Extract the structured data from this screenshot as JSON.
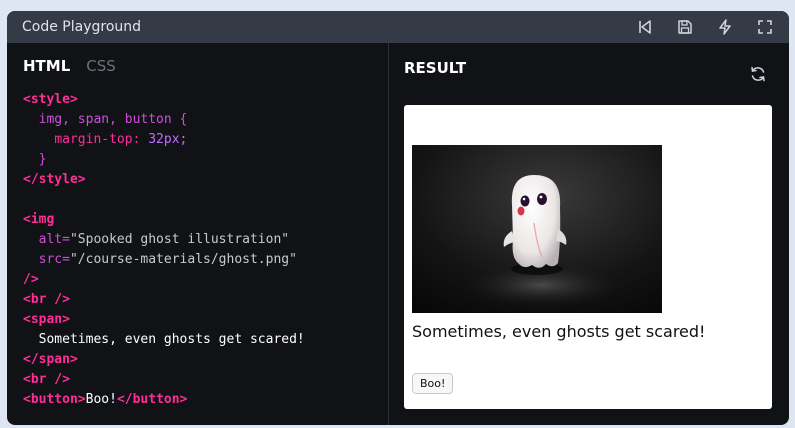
{
  "window": {
    "title": "Code Playground"
  },
  "toolbar": {
    "icons": [
      "rewind-icon",
      "save-icon",
      "lightning-icon",
      "fullscreen-icon"
    ]
  },
  "editor": {
    "tabs": [
      {
        "label": "HTML",
        "active": true
      },
      {
        "label": "CSS",
        "active": false
      }
    ]
  },
  "code": {
    "l1": "<style>",
    "l2_sel": "img, span, button {",
    "l3_prop": "margin-top:",
    "l3_val": "32px;",
    "l4": "}",
    "l5": "</style>",
    "l7": "<img",
    "l8_attr": "alt=",
    "l8_val": "\"Spooked ghost illustration\"",
    "l9_attr": "src=",
    "l9_val": "\"/course-materials/ghost.png\"",
    "l10": "/>",
    "l11": "<br />",
    "l12": "<span>",
    "l13": "Sometimes, even ghosts get scared!",
    "l14": "</span>",
    "l15": "<br />",
    "l16_open": "<button>",
    "l16_text": "Boo!",
    "l16_close": "</button>"
  },
  "result": {
    "title": "RESULT",
    "caption": "Sometimes, even ghosts get scared!",
    "button_label": "Boo!"
  },
  "colors": {
    "accent_pink": "#ff2e97",
    "accent_purple": "#cc4fd8",
    "titlebar": "#343a46",
    "editor_bg": "#101216"
  }
}
